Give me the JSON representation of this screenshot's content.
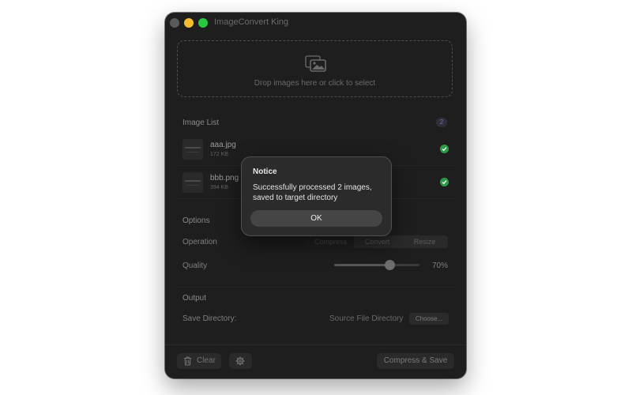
{
  "window": {
    "title": "ImageConvert King"
  },
  "drop_zone": {
    "text": "Drop images here or click to select",
    "icon": "photos-icon"
  },
  "image_list": {
    "title": "Image List",
    "count": "2",
    "items": [
      {
        "name": "aaa.jpg",
        "size": "172 KB",
        "status": "done"
      },
      {
        "name": "bbb.png",
        "size": "394 KB",
        "status": "done"
      }
    ]
  },
  "options": {
    "title": "Options",
    "operation_label": "Operation",
    "operations": [
      "Compress",
      "Convert",
      "Resize"
    ],
    "selected_operation": "Compress",
    "quality_label": "Quality",
    "quality_value": "70%",
    "quality_fraction": 0.7
  },
  "output": {
    "title": "Output",
    "save_dir_label": "Save Directory:",
    "save_dir_value": "Source File Directory",
    "choose_label": "Choose..."
  },
  "footer": {
    "clear_label": "Clear",
    "compress_save_label": "Compress & Save"
  },
  "dialog": {
    "title": "Notice",
    "message": "Successfully processed 2 images,\nsaved to target directory",
    "ok_label": "OK"
  },
  "colors": {
    "success": "#2e9a47",
    "close": "#5a5a5a",
    "minimize": "#f5bd2e",
    "maximize": "#29c840"
  }
}
